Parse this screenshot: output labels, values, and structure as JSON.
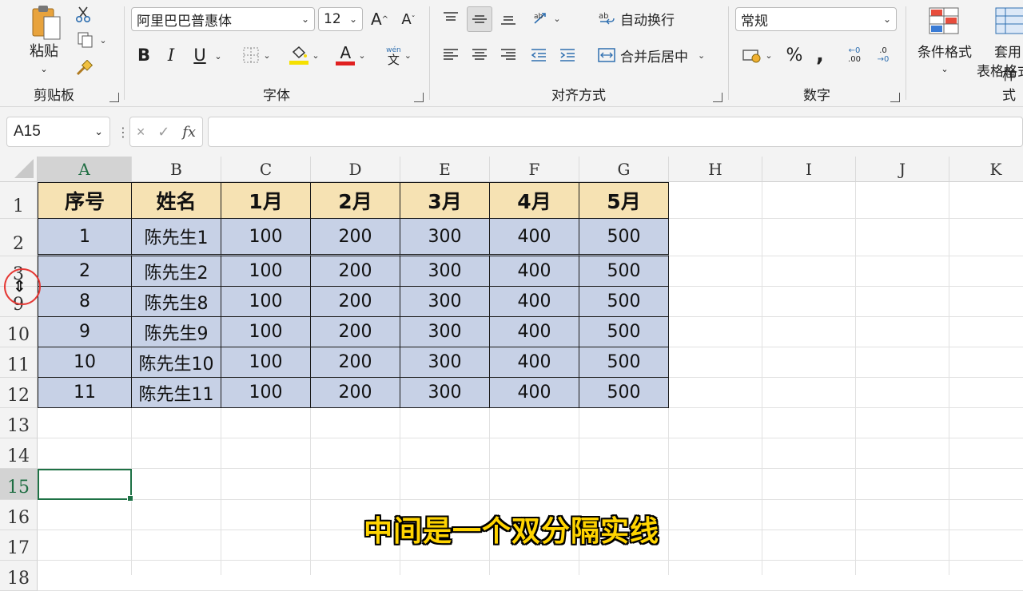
{
  "ribbon": {
    "clipboard": {
      "paste_label": "粘贴",
      "group_label": "剪贴板"
    },
    "font": {
      "font_name": "阿里巴巴普惠体",
      "font_size": "12",
      "grow_label": "A",
      "shrink_label": "A",
      "bold": "B",
      "italic": "I",
      "underline": "U",
      "fill_label": "A",
      "color_label": "A",
      "phonetic_label": "文",
      "group_label": "字体"
    },
    "alignment": {
      "wrap_label": "自动换行",
      "merge_label": "合并后居中",
      "group_label": "对齐方式"
    },
    "number": {
      "format": "常规",
      "percent": "%",
      "comma": ",",
      "inc_decimal": ".00",
      "dec_decimal": ".0",
      "group_label": "数字"
    },
    "styles": {
      "cond_format_label": "条件格式",
      "table_format_label_1": "套用",
      "table_format_label_2": "表格格式",
      "group_label": "样式"
    }
  },
  "formula_bar": {
    "name_box": "A15",
    "fx": "fx",
    "cancel": "×",
    "confirm": "✓",
    "formula": ""
  },
  "sheet": {
    "columns": [
      "A",
      "B",
      "C",
      "D",
      "E",
      "F",
      "G",
      "H",
      "I",
      "J",
      "K"
    ],
    "rows": [
      "1",
      "2",
      "3",
      "9",
      "10",
      "11",
      "12",
      "13",
      "14",
      "15",
      "16",
      "17",
      "18"
    ],
    "selected_column": "A",
    "selected_row": "15",
    "table": {
      "header": [
        "序号",
        "姓名",
        "1月",
        "2月",
        "3月",
        "4月",
        "5月"
      ],
      "body": [
        [
          "1",
          "陈先生1",
          "100",
          "200",
          "300",
          "400",
          "500"
        ],
        [
          "2",
          "陈先生2",
          "100",
          "200",
          "300",
          "400",
          "500"
        ],
        [
          "8",
          "陈先生8",
          "100",
          "200",
          "300",
          "400",
          "500"
        ],
        [
          "9",
          "陈先生9",
          "100",
          "200",
          "300",
          "400",
          "500"
        ],
        [
          "10",
          "陈先生10",
          "100",
          "200",
          "300",
          "400",
          "500"
        ],
        [
          "11",
          "陈先生11",
          "100",
          "200",
          "300",
          "400",
          "500"
        ]
      ]
    }
  },
  "subtitle": "中间是一个双分隔实线",
  "colors": {
    "header_fill": "#f6e2b3",
    "body_fill": "#c7d1e6",
    "selection": "#1e7145",
    "annotation": "#e53935",
    "subtitle": "#ffd400"
  }
}
